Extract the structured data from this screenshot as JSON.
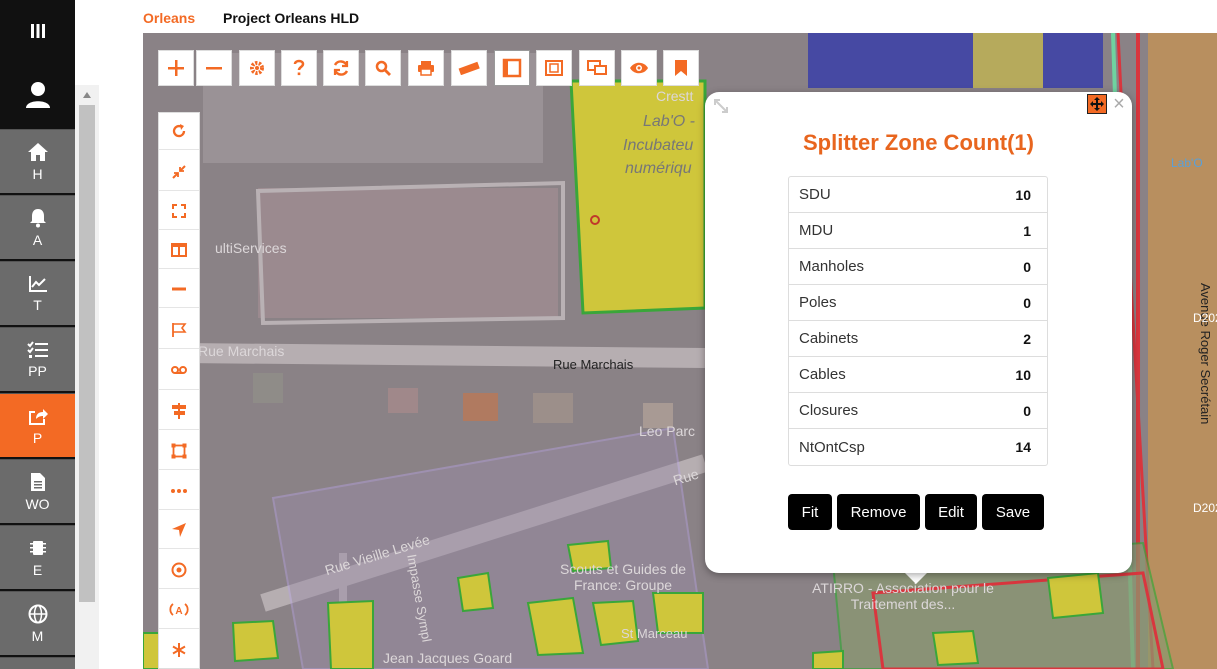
{
  "breadcrumb": {
    "project_group": "Orleans",
    "project_name": "Project Orleans HLD"
  },
  "colors": {
    "accent": "#f36a24",
    "sidebar_bg": "#111111",
    "sidebar_item_bg": "#6b6b6b",
    "title": "#e8651e"
  },
  "sidebar": {
    "menu_icon": "menu-icon",
    "user_icon": "user-icon",
    "items": [
      {
        "label": "H",
        "icon": "home-icon"
      },
      {
        "label": "A",
        "icon": "bell-icon"
      },
      {
        "label": "T",
        "icon": "chart-icon"
      },
      {
        "label": "PP",
        "icon": "checklist-icon"
      },
      {
        "label": "P",
        "icon": "share-icon",
        "active": true
      },
      {
        "label": "WO",
        "icon": "document-icon"
      },
      {
        "label": "E",
        "icon": "chip-icon"
      },
      {
        "label": "M",
        "icon": "globe-icon"
      }
    ]
  },
  "toolbar": {
    "top": [
      "zoom-in-icon",
      "zoom-out-icon",
      "settings-icon",
      "help-icon",
      "refresh-icon",
      "search-icon",
      "print-icon",
      "ruler-icon",
      "frame-icon",
      "fit-frame-icon",
      "screens-icon",
      "eye-icon",
      "bookmark-icon"
    ],
    "side": [
      "rotate-icon",
      "collapse-icon",
      "fullscreen-icon",
      "layout-icon",
      "minus-icon",
      "flag-icon",
      "cassette-icon",
      "signpost-icon",
      "polygon-icon",
      "more-icon",
      "navigate-icon",
      "target-icon",
      "broadcast-icon",
      "asterisk-icon"
    ]
  },
  "map": {
    "labels": [
      "Crestt",
      "Lab'O -",
      "Incubateu",
      "numériqu",
      "ultiServices",
      "Rue Marchais",
      "Rue Marchais",
      "Leo Parc",
      "Rue Vieille Levée",
      "Impasse Sympl",
      "Scouts et Guides de France: Groupe",
      "St Marceau",
      "Jean Jacques Goard",
      "ATIRRO - Association pour le Traitement des...",
      "Avenue Roger Secrétain",
      "Lab'O",
      "Rue",
      "D202",
      "D202"
    ]
  },
  "popup": {
    "title": "Splitter Zone Count(1)",
    "close": "×",
    "stats": [
      {
        "label": "SDU",
        "value": "10"
      },
      {
        "label": "MDU",
        "value": "1"
      },
      {
        "label": "Manholes",
        "value": "0"
      },
      {
        "label": "Poles",
        "value": "0"
      },
      {
        "label": "Cabinets",
        "value": "2"
      },
      {
        "label": "Cables",
        "value": "10"
      },
      {
        "label": "Closures",
        "value": "0"
      },
      {
        "label": "NtOntCsp",
        "value": "14"
      }
    ],
    "buttons": {
      "fit": "Fit",
      "remove": "Remove",
      "edit": "Edit",
      "save": "Save"
    }
  }
}
